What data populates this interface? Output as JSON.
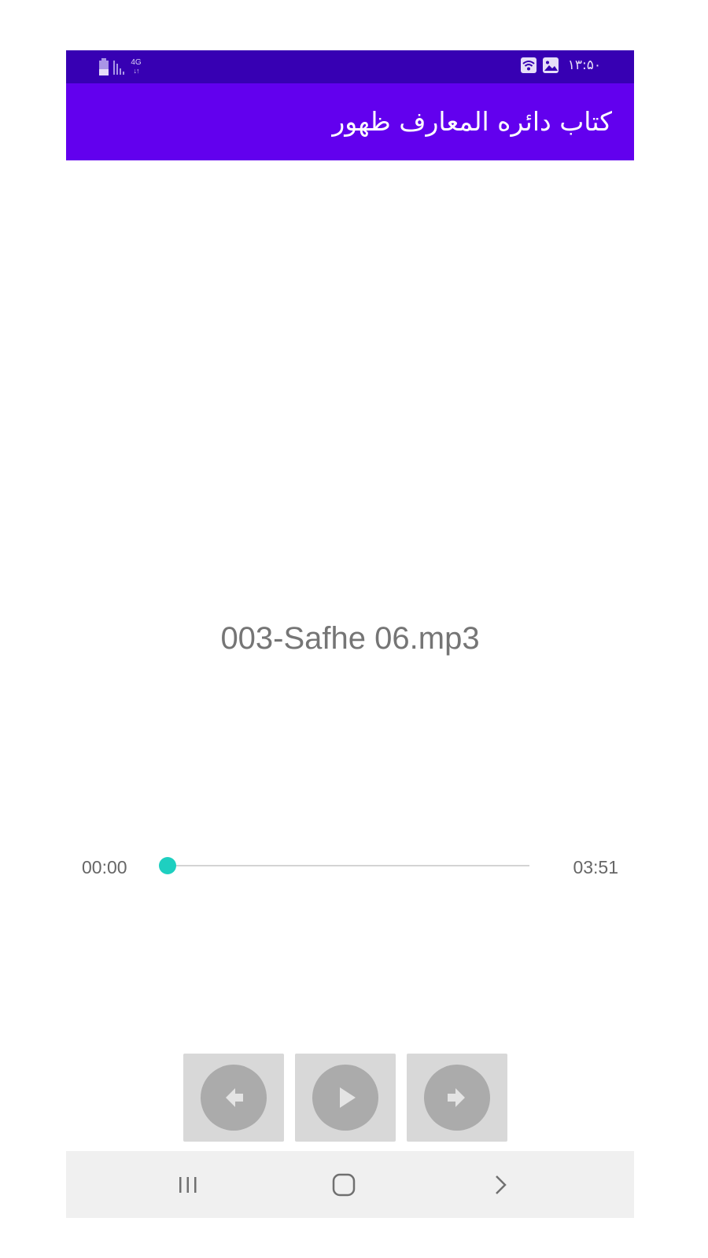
{
  "status_bar": {
    "time": "۱۳:۵۰",
    "network": "4G",
    "network_arrows": "↓↑",
    "icons": [
      "battery-icon",
      "signal-icon",
      "wifi-icon",
      "image-icon"
    ]
  },
  "app_bar": {
    "title": "کتاب دائره المعارف ظهور"
  },
  "player": {
    "file_name": "003-Safhe 06.mp3",
    "current_time": "00:00",
    "total_time": "03:51",
    "progress": 0
  },
  "controls": {
    "previous_icon": "arrow-left-icon",
    "play_icon": "play-icon",
    "next_icon": "arrow-right-icon"
  },
  "nav_bar": {
    "icons": [
      "recents-icon",
      "home-icon",
      "back-icon"
    ]
  },
  "colors": {
    "status_bar": "#3700b3",
    "app_bar": "#6200ee",
    "accent": "#1ecfc0"
  }
}
